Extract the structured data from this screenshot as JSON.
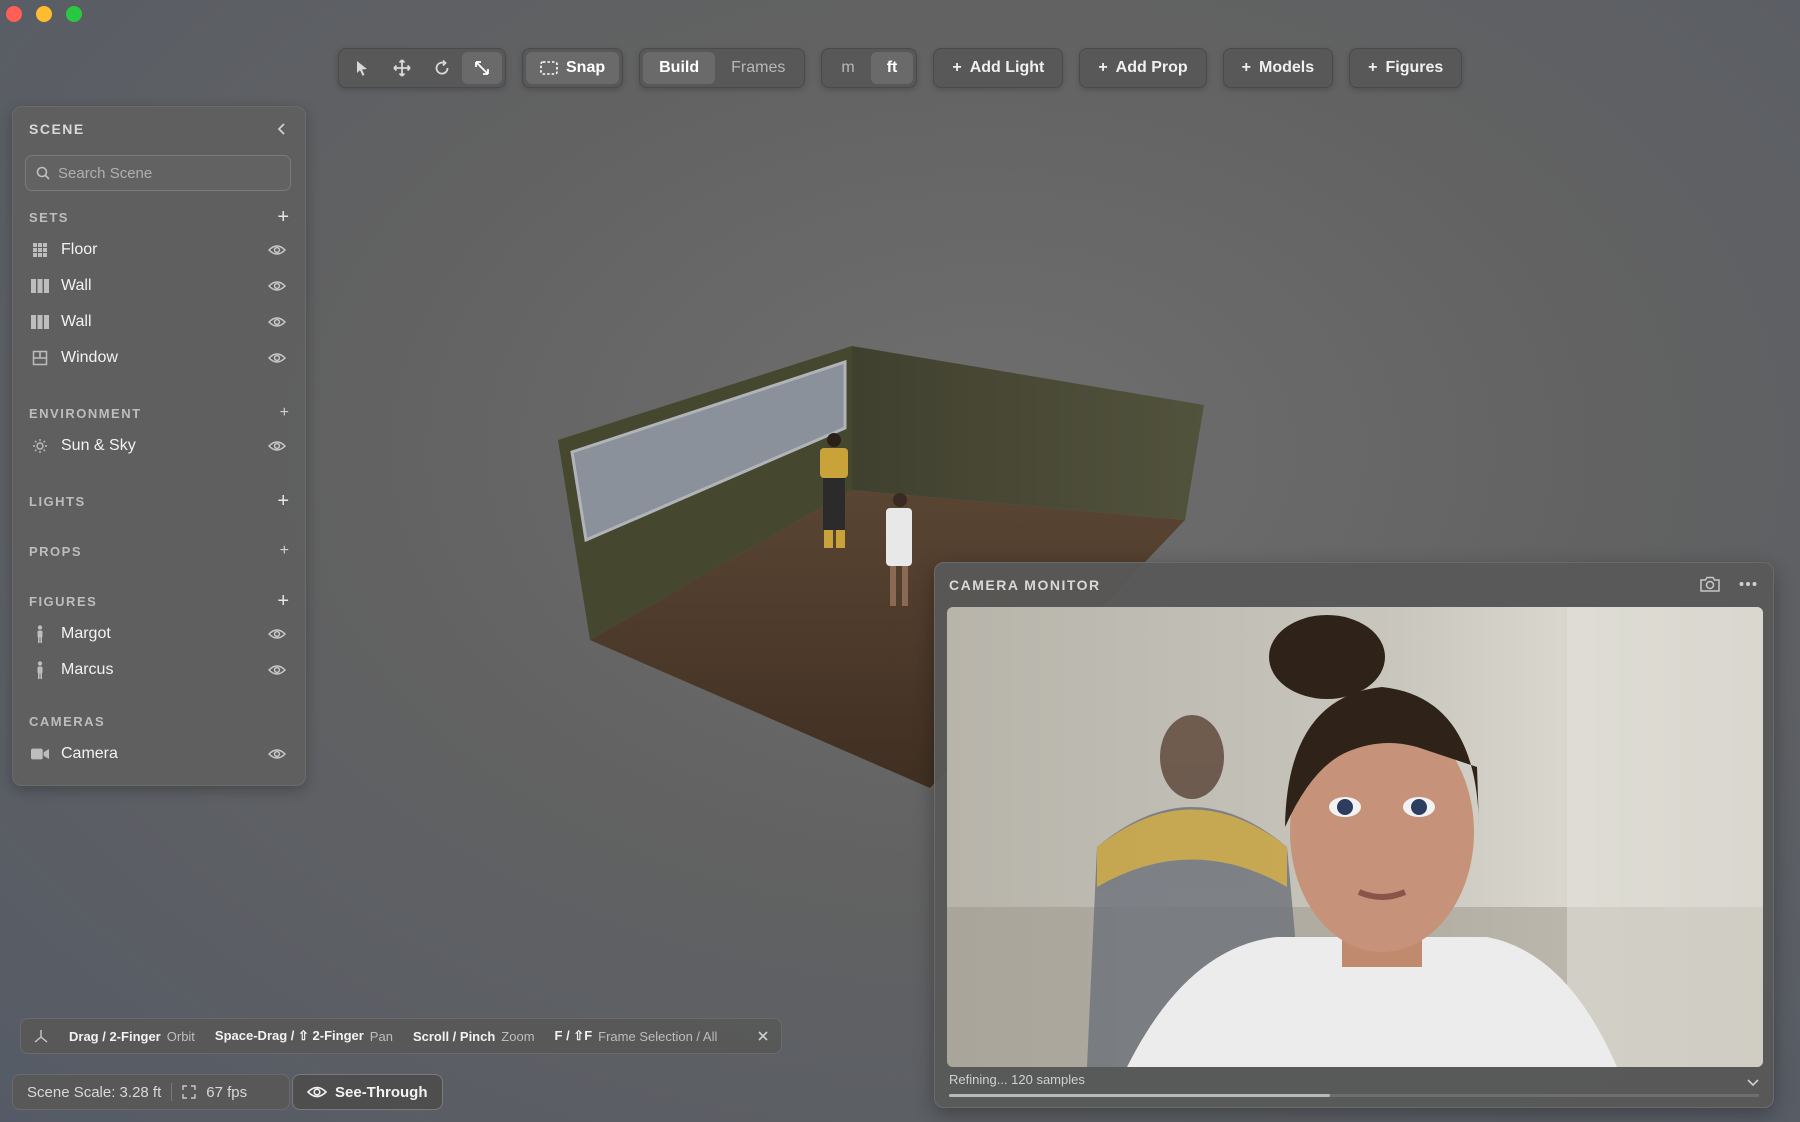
{
  "toolbar": {
    "tools": [
      "select-arrow-icon",
      "move-icon",
      "rotate-icon",
      "scale-icon"
    ],
    "active_tool": "scale-icon",
    "snap_label": "Snap",
    "mode_build": "Build",
    "mode_frames": "Frames",
    "unit_m": "m",
    "unit_ft": "ft",
    "add_light": "Add Light",
    "add_prop": "Add Prop",
    "models": "Models",
    "figures": "Figures"
  },
  "scene_panel": {
    "title": "SCENE",
    "search_placeholder": "Search Scene",
    "sets_label": "SETS",
    "sets": [
      {
        "label": "Floor",
        "icon": "grid-icon"
      },
      {
        "label": "Wall",
        "icon": "wall-icon"
      },
      {
        "label": "Wall",
        "icon": "wall-icon"
      },
      {
        "label": "Window",
        "icon": "window-icon"
      }
    ],
    "environment_label": "ENVIRONMENT",
    "environment": [
      {
        "label": "Sun & Sky",
        "icon": "sun-icon"
      }
    ],
    "lights_label": "LIGHTS",
    "props_label": "PROPS",
    "figures_label": "FIGURES",
    "figures": [
      {
        "label": "Margot",
        "icon": "person-icon"
      },
      {
        "label": "Marcus",
        "icon": "person-icon"
      }
    ],
    "cameras_label": "CAMERAS",
    "cameras": [
      {
        "label": "Camera",
        "icon": "video-camera-icon"
      }
    ]
  },
  "camera_monitor": {
    "title": "CAMERA MONITOR",
    "status": "Refining... 120 samples",
    "progress": 0.47
  },
  "hints": {
    "k1": "Drag / 2-Finger",
    "d1": "Orbit",
    "k2": "Space-Drag / ⇧ 2-Finger",
    "d2": "Pan",
    "k3": "Scroll / Pinch",
    "d3": "Zoom",
    "k4": "F / ⇧F",
    "d4": "Frame Selection / All"
  },
  "statusbar": {
    "scale": "Scene Scale: 3.28 ft",
    "fps": "67 fps",
    "see_through": "See-Through"
  },
  "colors": {
    "background": "#636363",
    "wall": "#4a4a35",
    "floor": "#4a3a2a",
    "window": "#8a919a"
  }
}
